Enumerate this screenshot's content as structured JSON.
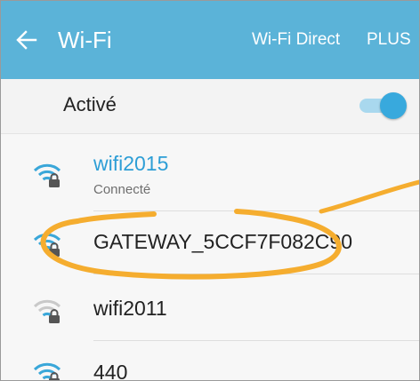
{
  "appbar": {
    "back_icon": "arrow-left-icon",
    "title": "Wi-Fi",
    "actions": [
      "Wi-Fi Direct",
      "PLUS"
    ]
  },
  "toggle": {
    "label": "Activé",
    "state": "on"
  },
  "networks": [
    {
      "name": "wifi2015",
      "status": "Connecté",
      "icon": "wifi-locked-icon",
      "connected": true,
      "signal": "full"
    },
    {
      "name": "GATEWAY_5CCF7F082C90",
      "status": "",
      "icon": "wifi-locked-icon",
      "connected": false,
      "signal": "full"
    },
    {
      "name": "wifi2011",
      "status": "",
      "icon": "wifi-locked-icon",
      "connected": false,
      "signal": "weak"
    },
    {
      "name": "440",
      "status": "",
      "icon": "wifi-locked-icon",
      "connected": false,
      "signal": "full"
    }
  ],
  "colors": {
    "appbar": "#5bb3d8",
    "accent": "#38a9dd",
    "annotation": "#f5ad2f"
  }
}
